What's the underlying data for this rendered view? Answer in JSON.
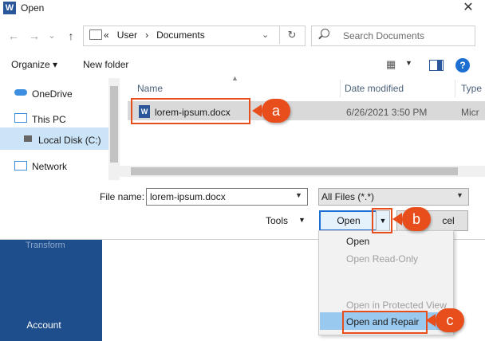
{
  "window": {
    "title": "Open",
    "app_icon": "W",
    "close_label": "✕"
  },
  "nav": {
    "back": "←",
    "forward": "→",
    "dropdown": "⌄",
    "up": "↑"
  },
  "address": {
    "prefix": "«",
    "crumb1": "User",
    "sep": "›",
    "crumb2": "Documents",
    "chevron": "⌄",
    "refresh": "↻"
  },
  "search": {
    "placeholder": "Search Documents"
  },
  "toolbar": {
    "organize": "Organize ▾",
    "new_folder": "New folder",
    "view_icon": "▦",
    "view_caret": "▼",
    "help": "?"
  },
  "sidebar": {
    "items": [
      {
        "label": "OneDrive",
        "icon": "cloud-icon"
      },
      {
        "label": "This PC",
        "icon": "computer-icon"
      },
      {
        "label": "Local Disk (C:)",
        "icon": "drive-icon"
      },
      {
        "label": "Network",
        "icon": "network-icon"
      }
    ]
  },
  "columns": {
    "name": "Name",
    "date": "Date modified",
    "type": "Type"
  },
  "files": [
    {
      "name": "lorem-ipsum.docx",
      "date": "6/26/2021 3:50 PM",
      "type": "Micr",
      "icon": "W"
    }
  ],
  "bottom": {
    "file_name_label": "File name:",
    "file_name_value": "lorem-ipsum.docx",
    "file_type_value": "All Files (*.*)",
    "tools_label": "Tools",
    "open_label": "Open",
    "cancel_label": "cel",
    "caret": "▼"
  },
  "menu": {
    "items": [
      {
        "label": "Open",
        "enabled": true
      },
      {
        "label": "Open Read-Only",
        "enabled": false
      },
      {
        "label": "Open in Protected View",
        "enabled": false
      },
      {
        "label": "Open and Repair",
        "enabled": true,
        "highlighted": true
      }
    ]
  },
  "background": {
    "transform": "Transform",
    "account": "Account"
  },
  "annotations": {
    "a": "a",
    "b": "b",
    "c": "c",
    "color": "#e84e1b"
  }
}
